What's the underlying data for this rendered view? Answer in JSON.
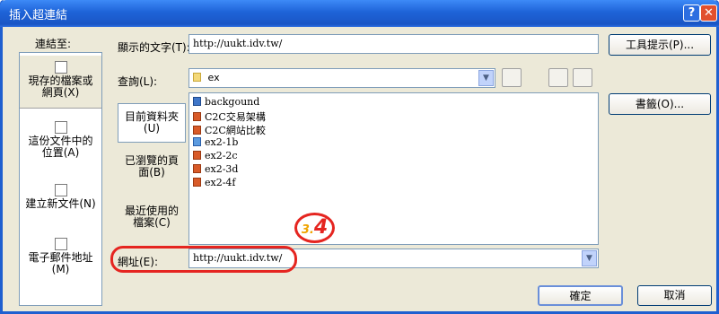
{
  "window": {
    "title": "插入超連結",
    "help_glyph": "?",
    "close_glyph": "✕"
  },
  "link_to": {
    "heading": "連結至:",
    "items": [
      {
        "label_l1": "現存的檔案或",
        "label_l2": "網頁(X)"
      },
      {
        "label_l1": "這份文件中的",
        "label_l2": "位置(A)"
      },
      {
        "label_l1": "建立新文件(N)",
        "label_l2": ""
      },
      {
        "label_l1": "電子郵件地址",
        "label_l2": "(M)"
      }
    ]
  },
  "display_text": {
    "label": "顯示的文字(T):",
    "value": "http://uukt.idv.tw/"
  },
  "screentip_button": "工具提示(P)...",
  "lookin": {
    "label": "查詢(L):",
    "value": "ex"
  },
  "inner_nav": [
    {
      "l1": "目前資料夾",
      "l2": "(U)"
    },
    {
      "l1": "已瀏覽的頁",
      "l2": "面(B)"
    },
    {
      "l1": "最近使用的",
      "l2": "檔案(C)"
    }
  ],
  "files": [
    {
      "name": "backgound",
      "icon": "folder-doc-icon"
    },
    {
      "name": "C2C交易架構",
      "icon": "ppt-icon"
    },
    {
      "name": "C2C網站比較",
      "icon": "ppt-icon"
    },
    {
      "name": "ex2-1b",
      "icon": "web-icon"
    },
    {
      "name": "ex2-2c",
      "icon": "ppt-icon"
    },
    {
      "name": "ex2-3d",
      "icon": "ppt-icon"
    },
    {
      "name": "ex2-4f",
      "icon": "ppt-icon"
    }
  ],
  "bookmark_button": "書籤(O)...",
  "address": {
    "label": "網址(E):",
    "value": "http://uukt.idv.tw/"
  },
  "ok_button": "確定",
  "cancel_button": "取消",
  "step_badge": {
    "prefix": "3.",
    "number": "4"
  },
  "colors": {
    "highlight": "#e52520",
    "titlebar": "#1e63d8"
  }
}
